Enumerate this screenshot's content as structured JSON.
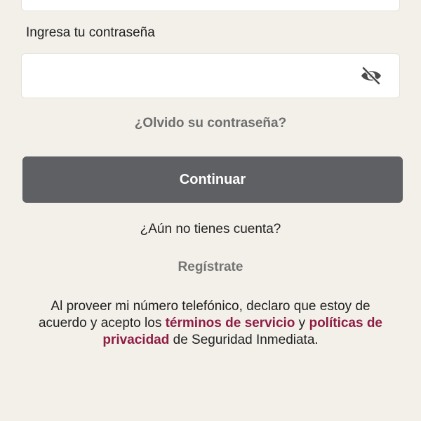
{
  "form": {
    "password_label": "Ingresa tu contraseña",
    "password_value": "",
    "forgot_label": "¿Olvido su contraseña?",
    "continue_label": "Continuar",
    "no_account_label": "¿Aún no tienes cuenta?",
    "register_label": "Regístrate"
  },
  "icons": {
    "password_toggle": "eye-off-icon"
  },
  "legal": {
    "part1": "Al proveer mi número telefónico, declaro que estoy de acuerdo y acepto los ",
    "terms_link": "términos de servicio",
    "part2": " y ",
    "privacy_link": "políticas de privacidad",
    "part3": " de Seguridad Inmediata."
  },
  "colors": {
    "background": "#f3f0ea",
    "button": "#5f6063",
    "link_accent": "#8e1c44",
    "muted_link": "#6e6e6e"
  }
}
